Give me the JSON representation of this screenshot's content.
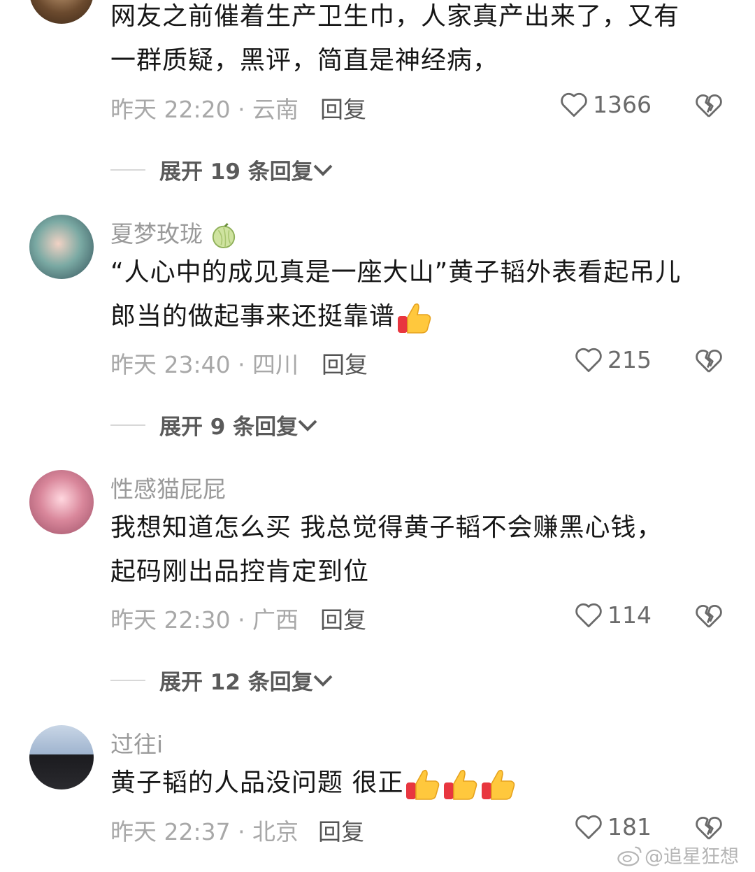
{
  "comments": [
    {
      "username": "",
      "text_lines": [
        "网友之前催着生产卫生巾，人家真产出来了，又有",
        "一群质疑，黑评，简直是神经病，"
      ],
      "time": "昨天 22:20 · 云南",
      "reply_label": "回复",
      "likes": "1366",
      "expand_label": "展开 19 条回复"
    },
    {
      "username": "夏梦玫珑",
      "text_lines": [
        "“人心中的成见真是一座大山”黄子韬外表看起吊儿",
        "郎当的做起事来还挺靠谱"
      ],
      "time": "昨天 23:40 · 四川",
      "reply_label": "回复",
      "likes": "215",
      "expand_label": "展开 9 条回复"
    },
    {
      "username": "性感猫屁屁",
      "text_lines": [
        "我想知道怎么买  我总觉得黄子韬不会赚黑心钱，",
        "起码刚出品控肯定到位"
      ],
      "time": "昨天 22:30 · 广西",
      "reply_label": "回复",
      "likes": "114",
      "expand_label": "展开 12 条回复"
    },
    {
      "username": "过往i",
      "text_lines": [
        "黄子韬的人品没问题 很正"
      ],
      "time": "昨天 22:37 · 北京",
      "reply_label": "回复",
      "likes": "181"
    }
  ],
  "watermark": "@追星狂想",
  "icons": {
    "like": "heart-outline-icon",
    "dislike": "broken-heart-icon",
    "expand": "chevron-down-icon",
    "emoji": "thumbs-up-emoji"
  }
}
